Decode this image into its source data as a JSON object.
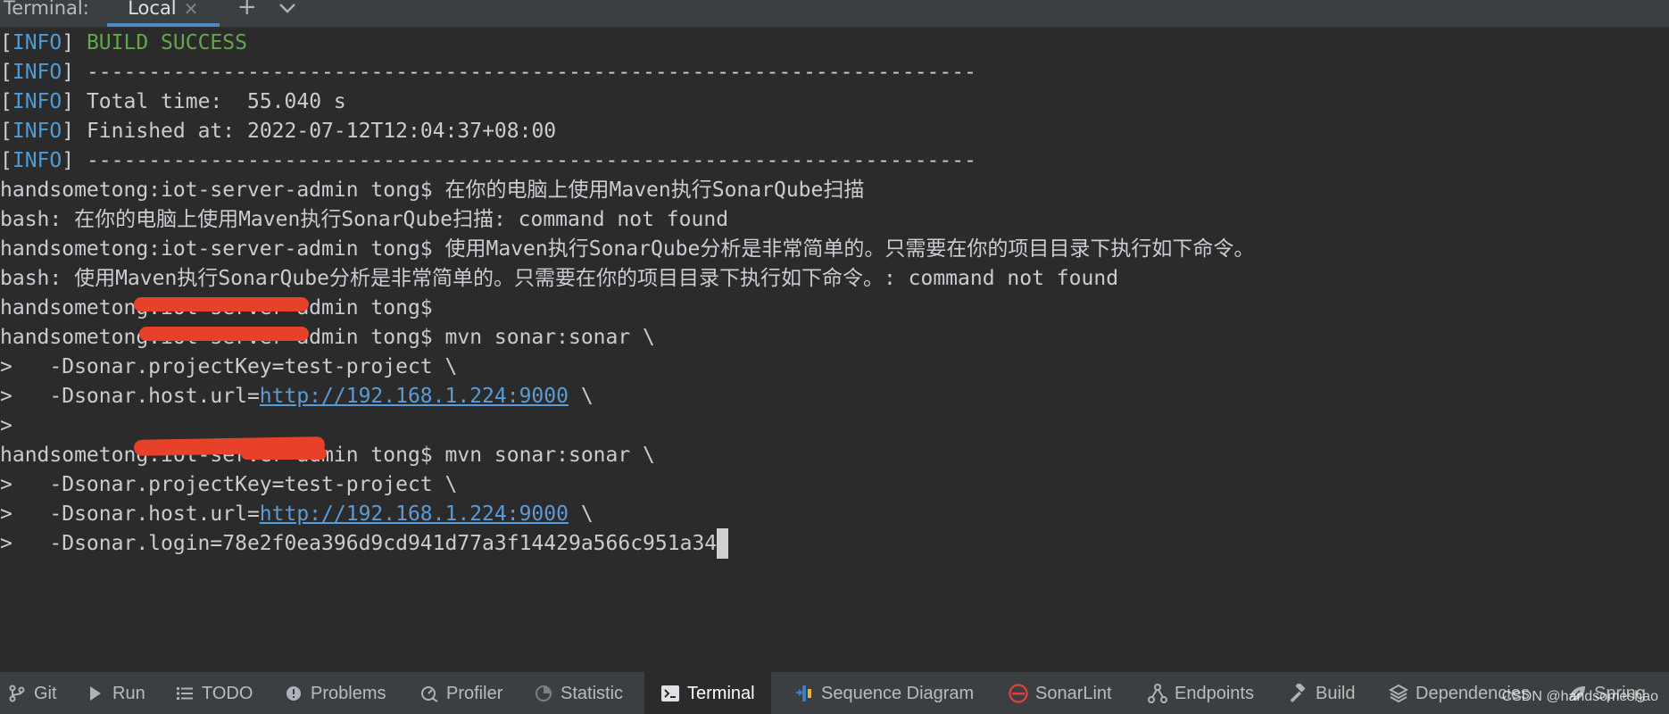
{
  "header": {
    "title": "Terminal:",
    "tab_label": "Local",
    "close_glyph": "×",
    "add_glyph": "+",
    "chevron_glyph": "⌄"
  },
  "terminal": {
    "lines": [
      {
        "prefix": "[",
        "tag": "INFO",
        "suffix": "] ",
        "text": "BUILD SUCCESS"
      },
      {
        "prefix": "[",
        "tag": "INFO",
        "suffix": "] ",
        "text": "------------------------------------------------------------------------"
      },
      {
        "prefix": "[",
        "tag": "INFO",
        "suffix": "] ",
        "text": "Total time:  55.040 s"
      },
      {
        "prefix": "[",
        "tag": "INFO",
        "suffix": "] ",
        "text": "Finished at: 2022-07-12T12:04:37+08:00"
      },
      {
        "prefix": "[",
        "tag": "INFO",
        "suffix": "] ",
        "text": "------------------------------------------------------------------------"
      },
      {
        "text": "handsometong:iot-server-admin tong$ 在你的电脑上使用Maven执行SonarQube扫描"
      },
      {
        "text": "bash: 在你的电脑上使用Maven执行SonarQube扫描: command not found"
      },
      {
        "text": "handsometong:iot-server-admin tong$ 使用Maven执行SonarQube分析是非常简单的。只需要在你的项目目录下执行如下命令。"
      },
      {
        "text": "bash: 使用Maven执行SonarQube分析是非常简单的。只需要在你的项目目录下执行如下命令。: command not found"
      },
      {
        "text": "handsometong:iot-server-admin tong$"
      },
      {
        "text": "handsometong:iot-server-admin tong$ mvn sonar:sonar \\"
      },
      {
        "text": ">   -Dsonar.projectKey=test-project \\"
      },
      {
        "pre": ">   -Dsonar.host.url=",
        "link": "http://192.168.1.224:9000",
        "post": " \\"
      },
      {
        "text": ">"
      },
      {
        "text": "handsometong:iot-server-admin tong$ mvn sonar:sonar \\"
      },
      {
        "text": ">   -Dsonar.projectKey=test-project \\"
      },
      {
        "pre": ">   -Dsonar.host.url=",
        "link": "http://192.168.1.224:9000",
        "post": " \\"
      },
      {
        "text": ">   -Dsonar.login=78e2f0ea396d9cd941d77a3f14429a566c951a34"
      }
    ]
  },
  "tool_bar": {
    "items": [
      {
        "label": "Git",
        "icon": "git-branch-icon",
        "active": false
      },
      {
        "label": "Run",
        "icon": "play-icon",
        "active": false
      },
      {
        "label": "TODO",
        "icon": "list-icon",
        "active": false
      },
      {
        "label": "Problems",
        "icon": "alert-circle-icon",
        "active": false
      },
      {
        "label": "Profiler",
        "icon": "profiler-icon",
        "active": false
      },
      {
        "label": "Statistic",
        "icon": "pie-chart-icon",
        "active": false
      },
      {
        "label": "Terminal",
        "icon": "terminal-icon",
        "active": true
      },
      {
        "label": "Sequence Diagram",
        "icon": "sequence-diagram-icon",
        "active": false
      },
      {
        "label": "SonarLint",
        "icon": "sonarlint-icon",
        "active": false
      },
      {
        "label": "Endpoints",
        "icon": "endpoints-icon",
        "active": false
      },
      {
        "label": "Build",
        "icon": "hammer-icon",
        "active": false
      },
      {
        "label": "Dependencies",
        "icon": "layers-icon",
        "active": false
      },
      {
        "label": "Spring",
        "icon": "spring-leaf-icon",
        "active": false
      }
    ]
  },
  "watermark": "CSDN @handsomeshao",
  "colors": {
    "info": "#4e9bd6",
    "success": "#62a74c",
    "link": "#5a9bd8",
    "redaction": "#e8412a",
    "sonarlint": "#e0413a"
  }
}
